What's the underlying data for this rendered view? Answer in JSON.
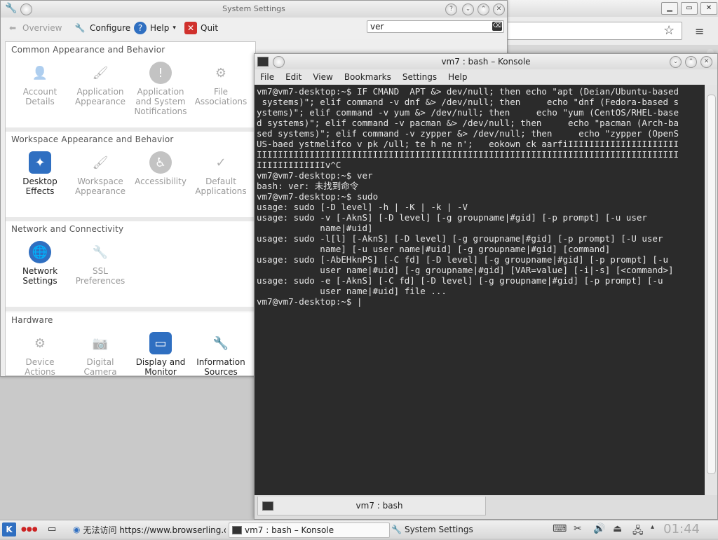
{
  "browser": {
    "star_icon": "star-icon",
    "menu_glyph": "≡"
  },
  "settings": {
    "title": "System Settings",
    "toolbar": {
      "overview": "Overview",
      "configure": "Configure",
      "help": "Help",
      "quit": "Quit"
    },
    "search_value": "ver",
    "categories": [
      {
        "heading": "Common Appearance and Behavior",
        "modules": [
          {
            "label": "Account Details",
            "dim": true
          },
          {
            "label": "Application Appearance",
            "dim": true
          },
          {
            "label": "Application and System Notifications",
            "dim": true
          },
          {
            "label": "File Associations",
            "dim": true
          }
        ]
      },
      {
        "heading": "Workspace Appearance and Behavior",
        "modules": [
          {
            "label": "Desktop Effects",
            "dim": false
          },
          {
            "label": "Workspace Appearance",
            "dim": true
          },
          {
            "label": "Accessibility",
            "dim": true
          },
          {
            "label": "Default Applications",
            "dim": true
          }
        ]
      },
      {
        "heading": "Network and Connectivity",
        "modules": [
          {
            "label": "Network Settings",
            "dim": false
          },
          {
            "label": "SSL Preferences",
            "dim": true
          }
        ]
      },
      {
        "heading": "Hardware",
        "modules": [
          {
            "label": "Device Actions",
            "dim": true
          },
          {
            "label": "Digital Camera",
            "dim": true
          },
          {
            "label": "Display and Monitor",
            "dim": false
          },
          {
            "label": "Information Sources",
            "dim": false
          }
        ]
      }
    ]
  },
  "konsole": {
    "title": "vm7 : bash – Konsole",
    "menu": [
      "File",
      "Edit",
      "View",
      "Bookmarks",
      "Settings",
      "Help"
    ],
    "tab_label": "vm7 : bash",
    "lines": [
      "vm7@vm7-desktop:~$ IF CMAND  APT &> dev/null; then echo \"apt (Deian/Ubuntu-based",
      " systems)\"; elif command -v dnf &> /dev/null; then     echo \"dnf (Fedora-based s",
      "ystems)\"; elif command -v yum &> /dev/null; then     echo \"yum (CentOS/RHEL-base",
      "d systems)\"; elif command -v pacman &> /dev/null; then     echo \"pacman (Arch-ba",
      "sed systems)\"; elif command -v zypper &> /dev/null; then     echo \"zypper (OpenS",
      "US-baed ystmelifco v pk /ull; te h ne n';   eokown ck aarfiIIIIIIIIIIIIIIIIIIIII",
      "IIIIIIIIIIIIIIIIIIIIIIIIIIIIIIIIIIIIIIIIIIIIIIIIIIIIIIIIIIIIIIIIIIIIIIIIIIIIIIII",
      "IIIIIIIIIIIIIv^C",
      "vm7@vm7-desktop:~$ ver",
      "bash: ver: 未找到命令",
      "vm7@vm7-desktop:~$ sudo",
      "usage: sudo [-D level] -h | -K | -k | -V",
      "usage: sudo -v [-AknS] [-D level] [-g groupname|#gid] [-p prompt] [-u user",
      "            name|#uid]",
      "usage: sudo -l[l] [-AknS] [-D level] [-g groupname|#gid] [-p prompt] [-U user",
      "            name] [-u user name|#uid] [-g groupname|#gid] [command]",
      "usage: sudo [-AbEHknPS] [-C fd] [-D level] [-g groupname|#gid] [-p prompt] [-u",
      "            user name|#uid] [-g groupname|#gid] [VAR=value] [-i|-s] [<command>]",
      "usage: sudo -e [-AknS] [-C fd] [-D level] [-g groupname|#gid] [-p prompt] [-u",
      "            user name|#uid] file ...",
      "vm7@vm7-desktop:~$ |"
    ]
  },
  "taskbar": {
    "browser_task": "无法访问 https://www.browserling.c",
    "konsole_task": "vm7 : bash – Konsole",
    "settings_task": "System Settings",
    "clock": "01:44"
  },
  "colors": {
    "terminal_bg": "#2b2b2b",
    "terminal_fg": "#e6e6e6",
    "accent_blue": "#2f6fc1",
    "quit_red": "#d0312d"
  }
}
